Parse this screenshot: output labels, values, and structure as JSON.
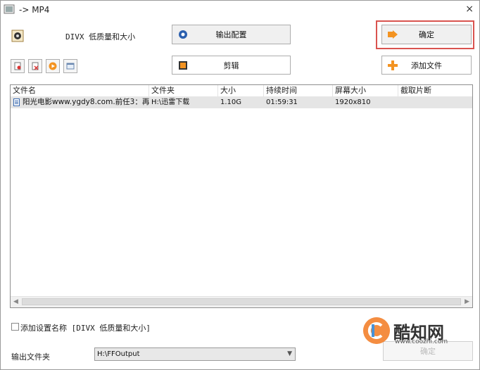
{
  "window": {
    "title": "-> MP4",
    "close_glyph": "×"
  },
  "preset": {
    "label": "DIVX 低质量和大小",
    "icon": "film-reel-icon"
  },
  "toolbar": {
    "output_config_label": "输出配置",
    "confirm_label": "确定",
    "clip_label": "剪辑",
    "add_file_label": "添加文件"
  },
  "file_list": {
    "columns": [
      "文件名",
      "文件夹",
      "大小",
      "持续时间",
      "屏幕大小",
      "截取片断"
    ],
    "rows": [
      {
        "name": "阳光电影www.ygdy8.com.前任3：再见...",
        "folder": "H:\\迅雷下载",
        "size": "1.10G",
        "duration": "01:59:31",
        "resolution": "1920x810",
        "clip": ""
      }
    ]
  },
  "options": {
    "add_preset_name_label": "添加设置名称 [DIVX 低质量和大小]"
  },
  "output": {
    "folder_label": "输出文件夹",
    "folder_value": "H:\\FFOutput"
  },
  "watermark": {
    "title": "酷知网",
    "url": "www.coozhi.com"
  },
  "obscured_button": {
    "label": "确定"
  },
  "colors": {
    "highlight": "#d9534f",
    "accent": "#f37a20"
  }
}
